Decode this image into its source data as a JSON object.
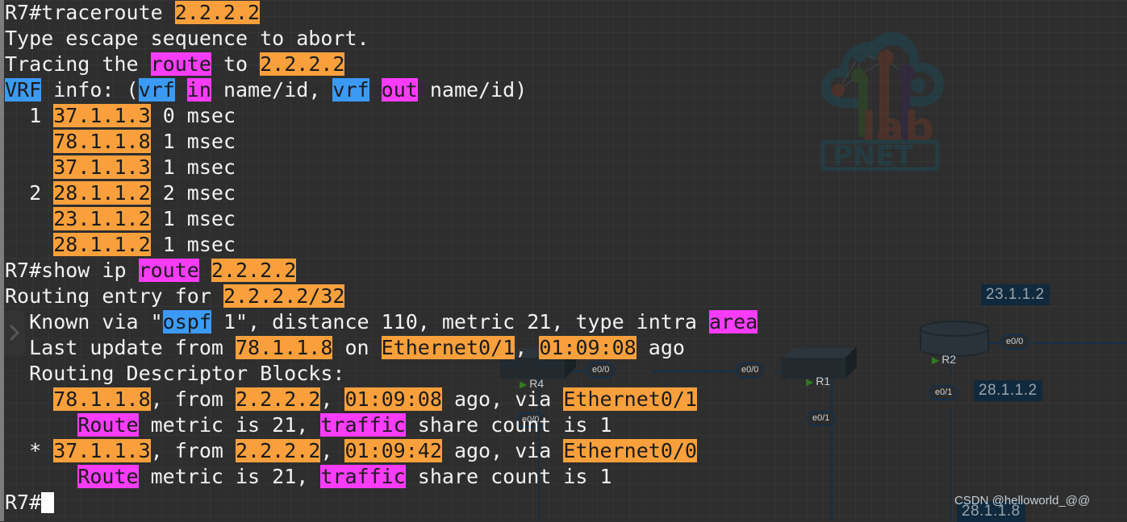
{
  "watermarks": {
    "csdn": "CSDN @helloworld_@@",
    "logo_name": "pnetlab-logo",
    "logo_text_top": "lab",
    "logo_text_bottom": "PNET"
  },
  "colors": {
    "background": "#2e2e2e",
    "highlight_orange": "#f9a03c",
    "highlight_magenta": "#f93cf9",
    "highlight_blue": "#3b9af5",
    "text": "#f2f2f2",
    "link": "#143049",
    "ip_tag_bg": "#10293d"
  },
  "topology": {
    "nodes": [
      {
        "name": "R4",
        "label": "R4",
        "type": "switch"
      },
      {
        "name": "R1",
        "label": "R1",
        "type": "switch"
      },
      {
        "name": "R2",
        "label": "R2",
        "type": "router"
      }
    ],
    "interfaces": [
      {
        "name": "iface-r4-e0-0",
        "label": "e0/0"
      },
      {
        "name": "iface-r1-e0-0",
        "label": "e0/0"
      },
      {
        "name": "iface-r1-e0-1",
        "label": "e0/1"
      },
      {
        "name": "iface-r2-e0-0",
        "label": "e0/0"
      },
      {
        "name": "iface-r2-e0-1",
        "label": "e0/1"
      },
      {
        "name": "iface-bottom-e0-0",
        "label": "e0/0"
      }
    ],
    "ip_tags": [
      {
        "name": "ip-tag-23-1-1-2",
        "label": "23.1.1.2"
      },
      {
        "name": "ip-tag-28-1-1-2",
        "label": "28.1.1.2"
      },
      {
        "name": "ip-tag-28-1-1-8",
        "label": "28.1.1.8"
      }
    ]
  },
  "terminal": {
    "lines": [
      {
        "name": "line-traceroute-cmd",
        "segments": [
          {
            "t": "R7#traceroute ",
            "s": "plain"
          },
          {
            "t": "2.2.2.2",
            "s": "orange"
          }
        ]
      },
      {
        "name": "line-escape-seq",
        "segments": [
          {
            "t": "Type escape sequence to abort.",
            "s": "plain"
          }
        ]
      },
      {
        "name": "line-tracing-route",
        "segments": [
          {
            "t": "Tracing the ",
            "s": "plain"
          },
          {
            "t": "route",
            "s": "magenta"
          },
          {
            "t": " to ",
            "s": "plain"
          },
          {
            "t": "2.2.2.2",
            "s": "orange"
          }
        ]
      },
      {
        "name": "line-vrf-info",
        "segments": [
          {
            "t": "VRF",
            "s": "blue"
          },
          {
            "t": " info: (",
            "s": "plain"
          },
          {
            "t": "vrf",
            "s": "blue"
          },
          {
            "t": " ",
            "s": "plain"
          },
          {
            "t": "in",
            "s": "magenta"
          },
          {
            "t": " name/id, ",
            "s": "plain"
          },
          {
            "t": "vrf",
            "s": "blue"
          },
          {
            "t": " ",
            "s": "plain"
          },
          {
            "t": "out",
            "s": "magenta"
          },
          {
            "t": " name/id)",
            "s": "plain"
          }
        ]
      },
      {
        "name": "line-hop-1-a",
        "segments": [
          {
            "t": "  1 ",
            "s": "plain"
          },
          {
            "t": "37.1.1.3",
            "s": "orange"
          },
          {
            "t": " 0 msec",
            "s": "plain"
          }
        ]
      },
      {
        "name": "line-hop-1-b",
        "segments": [
          {
            "t": "    ",
            "s": "plain"
          },
          {
            "t": "78.1.1.8",
            "s": "orange"
          },
          {
            "t": " 1 msec",
            "s": "plain"
          }
        ]
      },
      {
        "name": "line-hop-1-c",
        "segments": [
          {
            "t": "    ",
            "s": "plain"
          },
          {
            "t": "37.1.1.3",
            "s": "orange"
          },
          {
            "t": " 1 msec",
            "s": "plain"
          }
        ]
      },
      {
        "name": "line-hop-2-a",
        "segments": [
          {
            "t": "  2 ",
            "s": "plain"
          },
          {
            "t": "28.1.1.2",
            "s": "orange"
          },
          {
            "t": " 2 msec",
            "s": "plain"
          }
        ]
      },
      {
        "name": "line-hop-2-b",
        "segments": [
          {
            "t": "    ",
            "s": "plain"
          },
          {
            "t": "23.1.1.2",
            "s": "orange"
          },
          {
            "t": " 1 msec",
            "s": "plain"
          }
        ]
      },
      {
        "name": "line-hop-2-c",
        "segments": [
          {
            "t": "    ",
            "s": "plain"
          },
          {
            "t": "28.1.1.2",
            "s": "orange"
          },
          {
            "t": " 1 msec",
            "s": "plain"
          }
        ]
      },
      {
        "name": "line-show-ip-route-cmd",
        "segments": [
          {
            "t": "R7#show ip ",
            "s": "plain"
          },
          {
            "t": "route",
            "s": "magenta"
          },
          {
            "t": " ",
            "s": "plain"
          },
          {
            "t": "2.2.2.2",
            "s": "orange"
          }
        ]
      },
      {
        "name": "line-routing-entry",
        "segments": [
          {
            "t": "Routing entry for ",
            "s": "plain"
          },
          {
            "t": "2.2.2.2/32",
            "s": "orange"
          }
        ]
      },
      {
        "name": "line-known-via",
        "segments": [
          {
            "t": "  Known via \"",
            "s": "plain"
          },
          {
            "t": "ospf",
            "s": "blue"
          },
          {
            "t": " 1\", distance 110, metric 21, type intra ",
            "s": "plain"
          },
          {
            "t": "area",
            "s": "magenta"
          }
        ]
      },
      {
        "name": "line-last-update",
        "segments": [
          {
            "t": "  Last update from ",
            "s": "plain"
          },
          {
            "t": "78.1.1.8",
            "s": "orange"
          },
          {
            "t": " on ",
            "s": "plain"
          },
          {
            "t": "Ethernet0/1",
            "s": "orange"
          },
          {
            "t": ", ",
            "s": "plain"
          },
          {
            "t": "01:09:08",
            "s": "orange"
          },
          {
            "t": " ago",
            "s": "plain"
          }
        ]
      },
      {
        "name": "line-descriptor-blocks",
        "segments": [
          {
            "t": "  Routing Descriptor Blocks:",
            "s": "plain"
          }
        ]
      },
      {
        "name": "line-block-1-path",
        "segments": [
          {
            "t": "    ",
            "s": "plain"
          },
          {
            "t": "78.1.1.8",
            "s": "orange"
          },
          {
            "t": ", from ",
            "s": "plain"
          },
          {
            "t": "2.2.2.2",
            "s": "orange"
          },
          {
            "t": ", ",
            "s": "plain"
          },
          {
            "t": "01:09:08",
            "s": "orange"
          },
          {
            "t": " ago, via ",
            "s": "plain"
          },
          {
            "t": "Ethernet0/1",
            "s": "orange"
          }
        ]
      },
      {
        "name": "line-block-1-metric",
        "segments": [
          {
            "t": "      ",
            "s": "plain"
          },
          {
            "t": "Route",
            "s": "magenta"
          },
          {
            "t": " metric is 21, ",
            "s": "plain"
          },
          {
            "t": "traffic",
            "s": "magenta"
          },
          {
            "t": " share count is 1",
            "s": "plain"
          }
        ]
      },
      {
        "name": "line-block-2-path",
        "segments": [
          {
            "t": "  * ",
            "s": "plain"
          },
          {
            "t": "37.1.1.3",
            "s": "orange"
          },
          {
            "t": ", from ",
            "s": "plain"
          },
          {
            "t": "2.2.2.2",
            "s": "orange"
          },
          {
            "t": ", ",
            "s": "plain"
          },
          {
            "t": "01:09:42",
            "s": "orange"
          },
          {
            "t": " ago, via ",
            "s": "plain"
          },
          {
            "t": "Ethernet0/0",
            "s": "orange"
          }
        ]
      },
      {
        "name": "line-block-2-metric",
        "segments": [
          {
            "t": "      ",
            "s": "plain"
          },
          {
            "t": "Route",
            "s": "magenta"
          },
          {
            "t": " metric is 21, ",
            "s": "plain"
          },
          {
            "t": "traffic",
            "s": "magenta"
          },
          {
            "t": " share count is 1",
            "s": "plain"
          }
        ]
      },
      {
        "name": "line-prompt",
        "segments": [
          {
            "t": "R7#",
            "s": "plain"
          },
          {
            "t": "",
            "s": "cursor"
          }
        ]
      }
    ]
  }
}
